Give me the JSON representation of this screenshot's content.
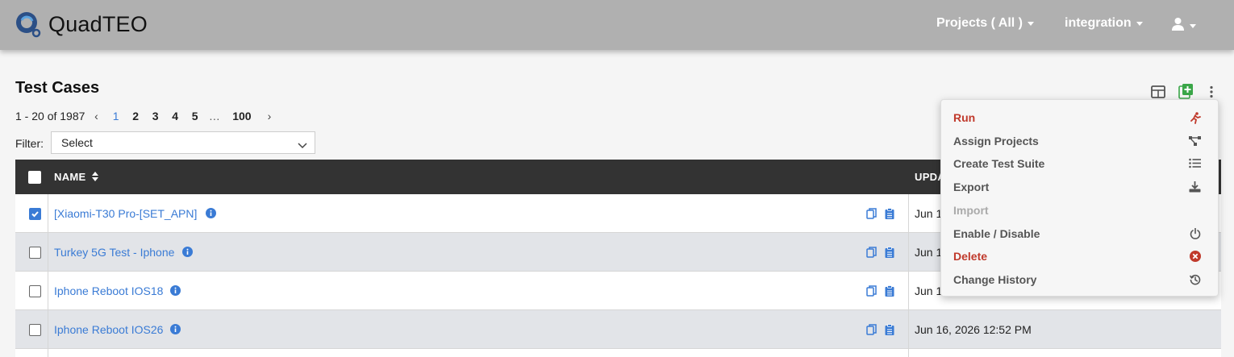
{
  "app": {
    "name": "QuadTEO"
  },
  "nav": {
    "projects_label": "Projects ( All )",
    "integration_label": "integration",
    "user_icon": "user-icon"
  },
  "page": {
    "title": "Test Cases"
  },
  "pagination": {
    "range_text": "1 - 20 of 1987",
    "pages": [
      "1",
      "2",
      "3",
      "4",
      "5"
    ],
    "active_page": "1",
    "ellipsis": "…",
    "last_page": "100",
    "prev": "‹",
    "next": "›"
  },
  "filter": {
    "label": "Filter:",
    "selected": "Select"
  },
  "table": {
    "columns": {
      "name": "NAME",
      "updated": "UPDA"
    },
    "rows": [
      {
        "name": "[Xiaomi-T30 Pro-[SET_APN]",
        "date": "Jun 1",
        "checked": true
      },
      {
        "name": "Turkey 5G Test - Iphone",
        "date": "Jun 1",
        "checked": false
      },
      {
        "name": "Iphone Reboot IOS18",
        "date": "Jun 1",
        "checked": false
      },
      {
        "name": "Iphone Reboot IOS26",
        "date": "Jun 16, 2026 12:52 PM",
        "checked": false
      }
    ]
  },
  "menu": {
    "items": [
      {
        "label": "Run",
        "icon": "run-icon",
        "style": "red"
      },
      {
        "label": "Assign Projects",
        "icon": "hierarchy-icon",
        "style": "normal"
      },
      {
        "label": "Create Test Suite",
        "icon": "list-icon",
        "style": "normal"
      },
      {
        "label": "Export",
        "icon": "download-icon",
        "style": "normal"
      },
      {
        "label": "Import",
        "icon": "",
        "style": "disabled"
      },
      {
        "label": "Enable / Disable",
        "icon": "power-icon",
        "style": "normal"
      },
      {
        "label": "Delete",
        "icon": "delete-circle-icon",
        "style": "red"
      },
      {
        "label": "Change History",
        "icon": "history-icon",
        "style": "normal"
      }
    ]
  },
  "colors": {
    "header_bg": "#b0b0b0",
    "table_header_bg": "#333333",
    "link_blue": "#3a7bd5",
    "danger_red": "#c0392b",
    "add_green": "#3aa648"
  }
}
